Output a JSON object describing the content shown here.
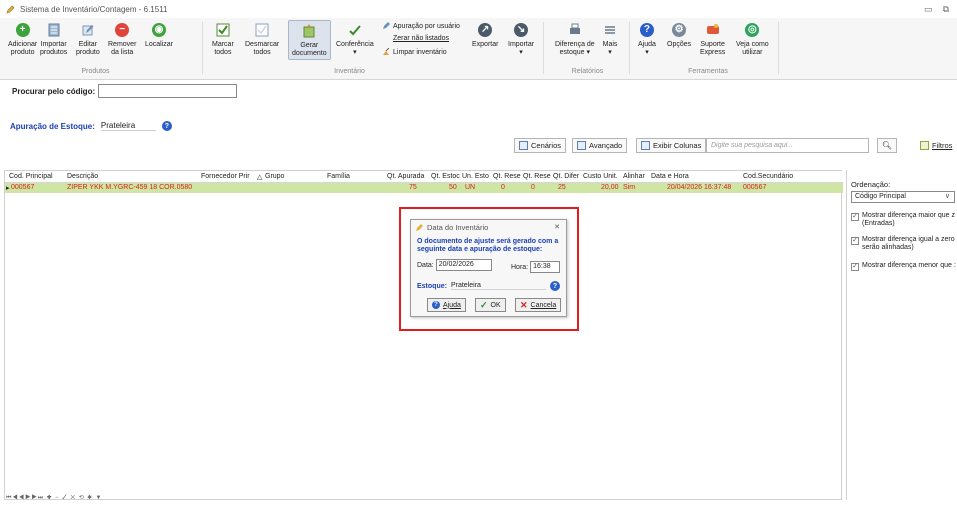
{
  "window": {
    "title": "Sistema de Inventário/Contagem - 6.1511"
  },
  "ribbon": {
    "groups": {
      "produtos": "Produtos",
      "inventario": "Inventário",
      "relatorios": "Relatórios",
      "ferramentas": "Ferramentas"
    },
    "buttons": {
      "adicionar": [
        "Adicionar",
        "produto"
      ],
      "importar": [
        "Importar",
        "produtos"
      ],
      "editar": [
        "Editar",
        "produto"
      ],
      "remover": [
        "Remover",
        "da lista"
      ],
      "localizar": [
        "Localizar"
      ],
      "marcar": [
        "Marcar",
        "todos"
      ],
      "desmarcar": [
        "Desmarcar",
        "todos"
      ],
      "gerar": [
        "Gerar",
        "documento"
      ],
      "conferencia": [
        "Conferência"
      ],
      "exportar": [
        "Exportar"
      ],
      "importar2": [
        "Importar"
      ],
      "diferenca": [
        "Diferença de",
        "estoque"
      ],
      "mais": [
        "Mais"
      ],
      "ajuda": [
        "Ajuda"
      ],
      "opcoes": [
        "Opções"
      ],
      "suporte": [
        "Suporte",
        "Express"
      ],
      "vejacomo": [
        "Veja como",
        "utilizar"
      ]
    },
    "small": {
      "apuracao": "Apuração por usuário",
      "zerar": "Zerar não listados",
      "limpar": "Limpar inventário"
    }
  },
  "search": {
    "label": "Procurar pelo código:",
    "value": ""
  },
  "apuracao": {
    "label": "Apuração de Estoque:",
    "value": "Prateleira"
  },
  "toolbar": {
    "cenarios": "Cenários",
    "avancado": "Avançado",
    "exibir_colunas": "Exibir Colunas",
    "search_placeholder": "Digite sua pesquisa aqui...",
    "filtros": "Filtros"
  },
  "grid": {
    "columns": [
      "Cod. Principal",
      "Descrição",
      "Fornecedor Prir",
      "Grupo",
      "Família",
      "Qt. Apurada",
      "Qt. Estoc",
      "Un. Esto",
      "Qt. Rese",
      "Qt. Rese",
      "Qt. Difer",
      "Custo Unit.",
      "Alinhar",
      "Data e Hora",
      "Cod.Secundário"
    ],
    "rows": [
      {
        "cod": "000567",
        "descricao": "ZIPER YKK M.YGRC-459 18 COR.0580",
        "qt_apurada": "75",
        "qt_estoque": "50",
        "un": "UN",
        "qt_rese1": "0",
        "qt_rese2": "0",
        "qt_difer": "25",
        "custo": "20,00",
        "alinhar": "Sim",
        "data_hora": "20/04/2026 16:37:48",
        "cod_sec": "000567"
      }
    ]
  },
  "panel": {
    "ordenacao_label": "Ordenação:",
    "ordenacao_value": "Código Principal",
    "checks": [
      [
        "Mostrar diferença maior que z",
        "(Entradas)"
      ],
      [
        "Mostrar diferença igual a zero",
        "serão alinhadas)"
      ],
      [
        "Mostrar diferença menor que :"
      ]
    ]
  },
  "dialog": {
    "title": "Data do Inventário",
    "message": "O documento de ajuste será gerado com a seguinte data e apuração de estoque:",
    "data_label": "Data:",
    "data_value": "20/02/2026",
    "hora_label": "Hora:",
    "hora_value": "16:38",
    "estoque_label": "Estoque:",
    "estoque_value": "Prateleira",
    "btn_ajuda": "Ajuda",
    "btn_ok": "OK",
    "btn_cancela": "Cancela"
  },
  "colors": {
    "accent": "#1a3fb3",
    "row_highlight": "#cfe5a3",
    "row_text": "#d61f1f",
    "callout": "#e11d1d"
  }
}
